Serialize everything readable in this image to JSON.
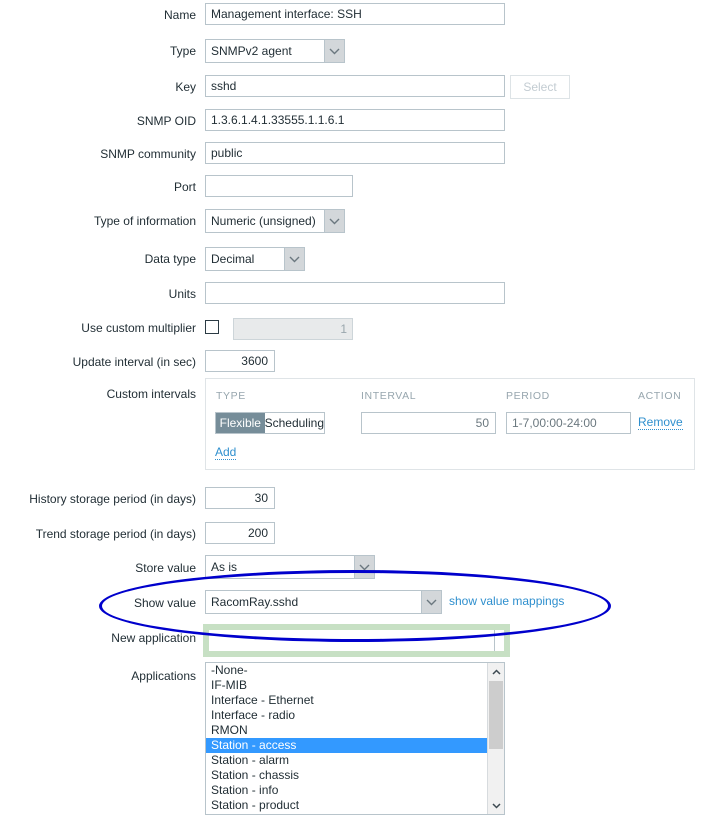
{
  "form": {
    "rows": [
      {
        "label": "Name",
        "value": "Management interface: SSH"
      },
      {
        "label": "Type",
        "value": "SNMPv2 agent"
      },
      {
        "label": "Key",
        "value": "sshd"
      },
      {
        "label": "SNMP OID",
        "value": "1.3.6.1.4.1.33555.1.1.6.1"
      },
      {
        "label": "SNMP community",
        "value": "public"
      },
      {
        "label": "Port",
        "value": ""
      },
      {
        "label": "Type of information",
        "value": "Numeric (unsigned)"
      },
      {
        "label": "Data type",
        "value": "Decimal"
      },
      {
        "label": "Units",
        "value": ""
      },
      {
        "label": "Use custom multiplier",
        "value": "1"
      },
      {
        "label": "Update interval (in sec)",
        "value": "3600"
      },
      {
        "label": "Custom intervals",
        "value": ""
      },
      {
        "label": "History storage period (in days)",
        "value": "30"
      },
      {
        "label": "Trend storage period (in days)",
        "value": "200"
      },
      {
        "label": "Store value",
        "value": "As is"
      },
      {
        "label": "Show value",
        "value": "RacomRay.sshd"
      },
      {
        "label": "New application",
        "value": ""
      },
      {
        "label": "Applications",
        "value": ""
      }
    ],
    "select_button_label": "Select",
    "show_value_mappings_link": "show value mappings"
  },
  "custom_intervals": {
    "headers": [
      "TYPE",
      "INTERVAL",
      "PERIOD",
      "ACTION"
    ],
    "rows": [
      {
        "type_flexible": "Flexible",
        "type_scheduling": "Scheduling",
        "interval": "50",
        "period": "1-7,00:00-24:00",
        "action": "Remove"
      }
    ],
    "add_label": "Add"
  },
  "applications": {
    "items": [
      {
        "label": "-None-",
        "selected": false
      },
      {
        "label": "IF-MIB",
        "selected": false
      },
      {
        "label": "Interface - Ethernet",
        "selected": false
      },
      {
        "label": "Interface - radio",
        "selected": false
      },
      {
        "label": "RMON",
        "selected": false
      },
      {
        "label": "Station - access",
        "selected": true
      },
      {
        "label": "Station - alarm",
        "selected": false
      },
      {
        "label": "Station - chassis",
        "selected": false
      },
      {
        "label": "Station - info",
        "selected": false
      },
      {
        "label": "Station - product",
        "selected": false
      }
    ]
  },
  "colors": {
    "annotation_ellipse": "#0000cc",
    "annotation_highlight": "#c7e0c4",
    "selection": "#3399ff",
    "link": "#2e8fce",
    "toggle_active": "#768d99"
  }
}
